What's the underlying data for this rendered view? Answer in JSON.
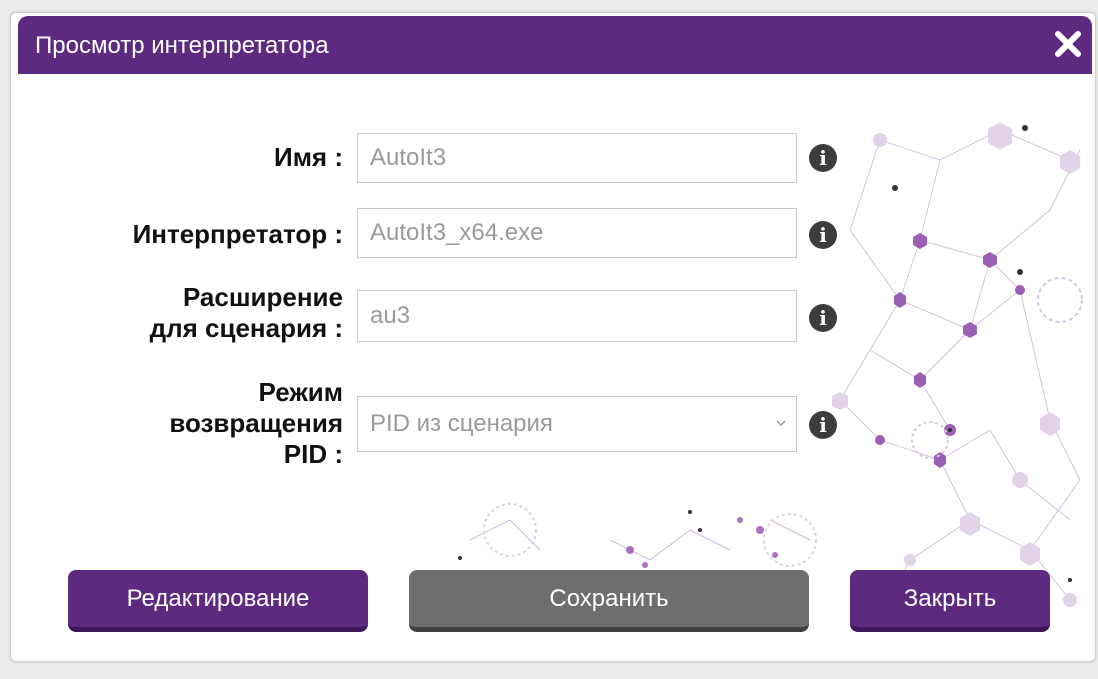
{
  "dialog": {
    "title": "Просмотр интерпретатора"
  },
  "form": {
    "name": {
      "label": "Имя :",
      "value": "AutoIt3"
    },
    "interpreter": {
      "label": "Интерпретатор :",
      "value": "AutoIt3_x64.exe"
    },
    "extension": {
      "label_line1": "Расширение",
      "label_line2": "для сценария :",
      "value": "au3"
    },
    "pid_mode": {
      "label_line1": "Режим",
      "label_line2": "возвращения",
      "label_line3": "PID :",
      "selected": "PID из сценария"
    }
  },
  "buttons": {
    "edit": "Редактирование",
    "save": "Сохранить",
    "close": "Закрыть"
  },
  "colors": {
    "accent": "#5d2a80",
    "save_button": "#6e6e71"
  },
  "icons": {
    "close": "close-icon",
    "info": "info-icon",
    "dropdown": "chevron-down-icon"
  }
}
